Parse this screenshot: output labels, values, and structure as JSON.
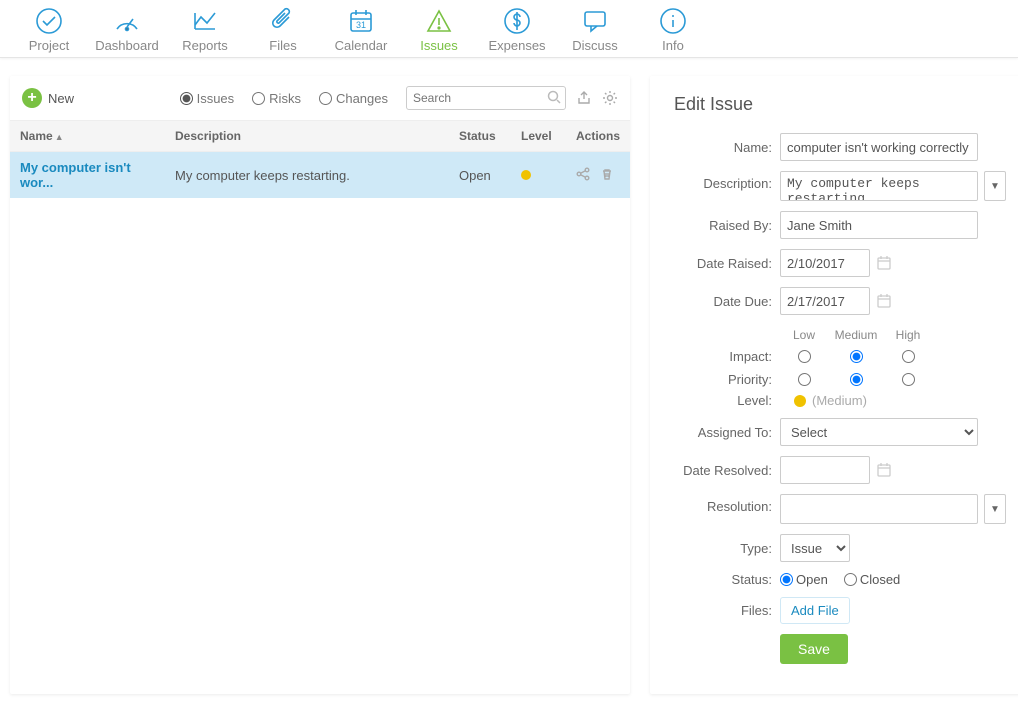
{
  "nav": {
    "items": [
      {
        "key": "project",
        "label": "Project"
      },
      {
        "key": "dashboard",
        "label": "Dashboard"
      },
      {
        "key": "reports",
        "label": "Reports"
      },
      {
        "key": "files",
        "label": "Files"
      },
      {
        "key": "calendar",
        "label": "Calendar"
      },
      {
        "key": "issues",
        "label": "Issues",
        "active": true
      },
      {
        "key": "expenses",
        "label": "Expenses"
      },
      {
        "key": "discuss",
        "label": "Discuss"
      },
      {
        "key": "info",
        "label": "Info"
      }
    ]
  },
  "toolbar": {
    "new_label": "New",
    "filters": {
      "issues": "Issues",
      "risks": "Risks",
      "changes": "Changes",
      "selected": "issues"
    },
    "search_placeholder": "Search"
  },
  "table": {
    "columns": {
      "name": "Name",
      "description": "Description",
      "status": "Status",
      "level": "Level",
      "actions": "Actions"
    },
    "rows": [
      {
        "name": "My computer isn't wor...",
        "description": "My computer keeps restarting.",
        "status": "Open",
        "level": "medium"
      }
    ]
  },
  "form": {
    "heading": "Edit Issue",
    "labels": {
      "name": "Name:",
      "description": "Description:",
      "raised_by": "Raised By:",
      "date_raised": "Date Raised:",
      "date_due": "Date Due:",
      "impact": "Impact:",
      "priority": "Priority:",
      "level": "Level:",
      "assigned_to": "Assigned To:",
      "date_resolved": "Date Resolved:",
      "resolution": "Resolution:",
      "type": "Type:",
      "status": "Status:",
      "files": "Files:"
    },
    "values": {
      "name": "computer isn't working correctly",
      "description": "My computer keeps restarting.",
      "raised_by": "Jane Smith",
      "date_raised": "2/10/2017",
      "date_due": "2/17/2017",
      "impact": "Medium",
      "priority": "Medium",
      "level_text": "(Medium)",
      "assigned_to": "Select",
      "date_resolved": "",
      "resolution": "",
      "type": "Issue",
      "status": "Open"
    },
    "scale_labels": {
      "low": "Low",
      "medium": "Medium",
      "high": "High"
    },
    "status_options": {
      "open": "Open",
      "closed": "Closed"
    },
    "buttons": {
      "add_file": "Add File",
      "save": "Save"
    }
  }
}
